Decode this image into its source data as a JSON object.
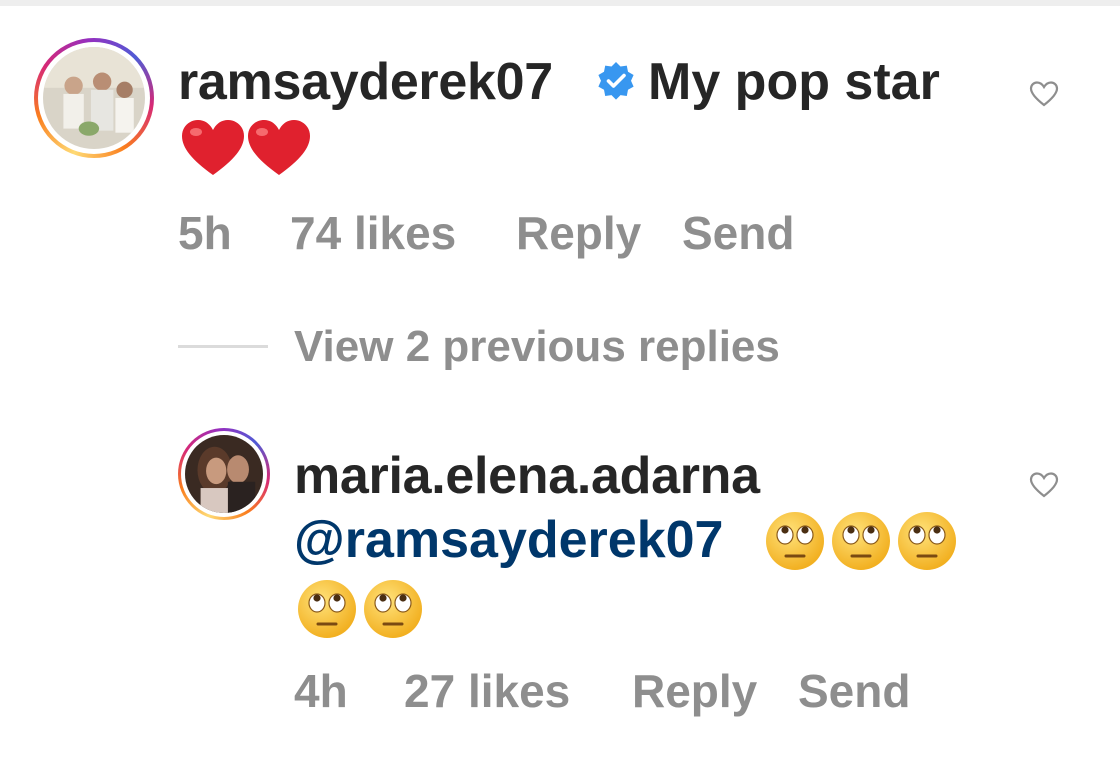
{
  "comment": {
    "username": "ramsayderek07",
    "text": "My pop star",
    "emojis": [
      "red-heart",
      "red-heart"
    ],
    "time": "5h",
    "likes": "74 likes",
    "reply_label": "Reply",
    "send_label": "Send"
  },
  "view_replies": "View 2 previous replies",
  "reply": {
    "username": "maria.elena.adarna",
    "mention": "@ramsayderek07",
    "emojis": [
      "face-with-rolling-eyes",
      "face-with-rolling-eyes",
      "face-with-rolling-eyes",
      "face-with-rolling-eyes",
      "face-with-rolling-eyes"
    ],
    "time": "4h",
    "likes": "27 likes",
    "reply_label": "Reply",
    "send_label": "Send"
  },
  "colors": {
    "text": "#262626",
    "meta": "#8e8e8e",
    "mention": "#00376b",
    "verified": "#3897f0",
    "heart": "#e0212e"
  },
  "icons": [
    "verified-badge-icon",
    "like-heart-icon"
  ]
}
